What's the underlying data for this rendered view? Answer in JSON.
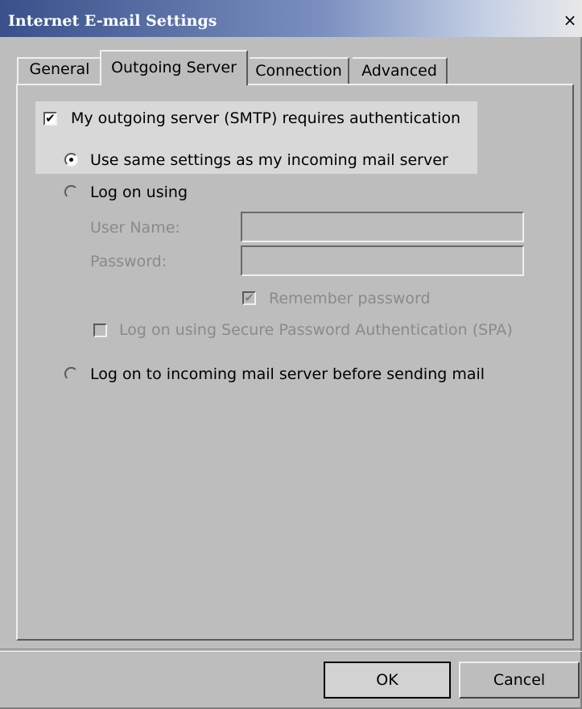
{
  "window": {
    "title": "Internet E-mail Settings",
    "close_glyph": "×"
  },
  "tabs": [
    {
      "label": "General",
      "active": false
    },
    {
      "label": "Outgoing Server",
      "active": true
    },
    {
      "label": "Connection",
      "active": false
    },
    {
      "label": "Advanced",
      "active": false
    }
  ],
  "auth": {
    "requires_auth_label": "My outgoing server (SMTP) requires authentication",
    "requires_auth_checked": true,
    "same_settings_label": "Use same settings as my incoming mail server",
    "same_settings_selected": true,
    "logon_using_label": "Log on using",
    "logon_using_selected": false,
    "username_label": "User Name:",
    "username_value": "",
    "password_label": "Password:",
    "password_value": "",
    "remember_password_label": "Remember password",
    "remember_password_checked": true,
    "spa_label": "Log on using Secure Password Authentication (SPA)",
    "spa_checked": false,
    "logon_incoming_label": "Log on to incoming mail server before sending mail",
    "logon_incoming_selected": false,
    "check_glyph": "✔"
  },
  "buttons": {
    "ok": "OK",
    "cancel": "Cancel"
  }
}
